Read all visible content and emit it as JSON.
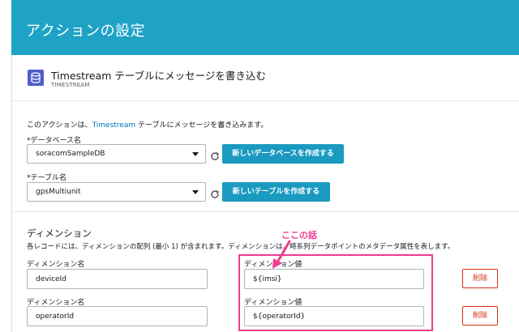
{
  "header": {
    "title": "アクションの設定"
  },
  "action": {
    "title": "Timestream テーブルにメッセージを書き込む",
    "subtitle": "TIMESTREAM",
    "description_pre": "このアクションは、",
    "description_link": "Timestream",
    "description_post": " テーブルにメッセージを書き込みます。"
  },
  "database": {
    "label": "*データベース名",
    "value": "soracomSampleDB",
    "create_button": "新しいデータベースを作成する"
  },
  "table": {
    "label": "*テーブル名",
    "value": "gpsMultiunit",
    "create_button": "新しいテーブルを作成する"
  },
  "dimensions": {
    "title": "ディメンション",
    "description": "各レコードには、ディメンションの配列 (最小 1) が含まれます。ディメンションは、時系列データポイントのメタデータ属性を表します。",
    "name_label": "ディメンション名",
    "value_label": "ディメンション値",
    "delete_label": "削除",
    "rows": [
      {
        "name": "deviceId",
        "value": "${imsi}"
      },
      {
        "name": "operatorId",
        "value": "${operatorId}"
      }
    ]
  },
  "annotation": {
    "text": "ここの話"
  },
  "colors": {
    "header": "#1ea3c6",
    "primary_button": "#1a9ac0",
    "annotation": "#ee3d8f",
    "delete": "#d13212",
    "link": "#0073bb"
  },
  "icons": {
    "service": "timestream-icon",
    "refresh": "refresh-icon",
    "dropdown": "caret-down-icon",
    "arrow": "arrow-icon"
  }
}
